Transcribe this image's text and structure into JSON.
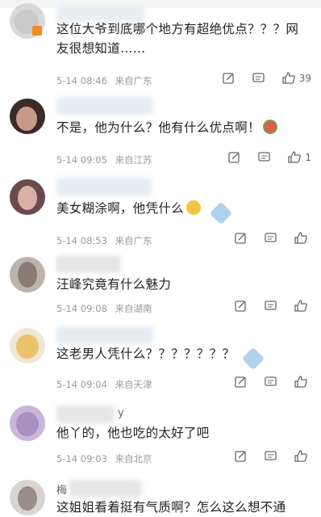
{
  "comments": [
    {
      "name_prefix": "",
      "text_lines": [
        "这位大爷到底哪个地方有超绝优点？？？网",
        "友很想知道……"
      ],
      "date": "5-14 08:46",
      "location": "来自广东",
      "likes": "39"
    },
    {
      "name_prefix": "",
      "text_lines": [
        "不是，他为什么？他有什么优点啊！"
      ],
      "date": "5-14 09:05",
      "location": "来自江苏",
      "likes": "1"
    },
    {
      "name_prefix": "",
      "text_lines": [
        "美女糊涂啊，他凭什么"
      ],
      "date": "5-14 08:53",
      "location": "来自广东",
      "likes": ""
    },
    {
      "name_prefix": "",
      "text_lines": [
        "汪峰究竟有什么魅力"
      ],
      "date": "5-14 09:08",
      "location": "来自湖南",
      "likes": ""
    },
    {
      "name_prefix": "",
      "text_lines": [
        "这老男人凭什么？？？？？？？"
      ],
      "date": "5-14 09:04",
      "location": "来自天津",
      "likes": ""
    },
    {
      "name_prefix": "y",
      "text_lines": [
        "他丫的，他也吃的太好了吧"
      ],
      "date": "5-14 09:03",
      "location": "来自北京",
      "likes": ""
    },
    {
      "name_prefix": "梅",
      "text_lines": [
        "这姐姐看着挺有气质啊？怎么这么想不通"
      ],
      "date": "",
      "location": "",
      "likes": ""
    }
  ],
  "icons": {
    "share": "share-icon",
    "comment": "comment-icon",
    "like": "thumbs-up-icon"
  }
}
